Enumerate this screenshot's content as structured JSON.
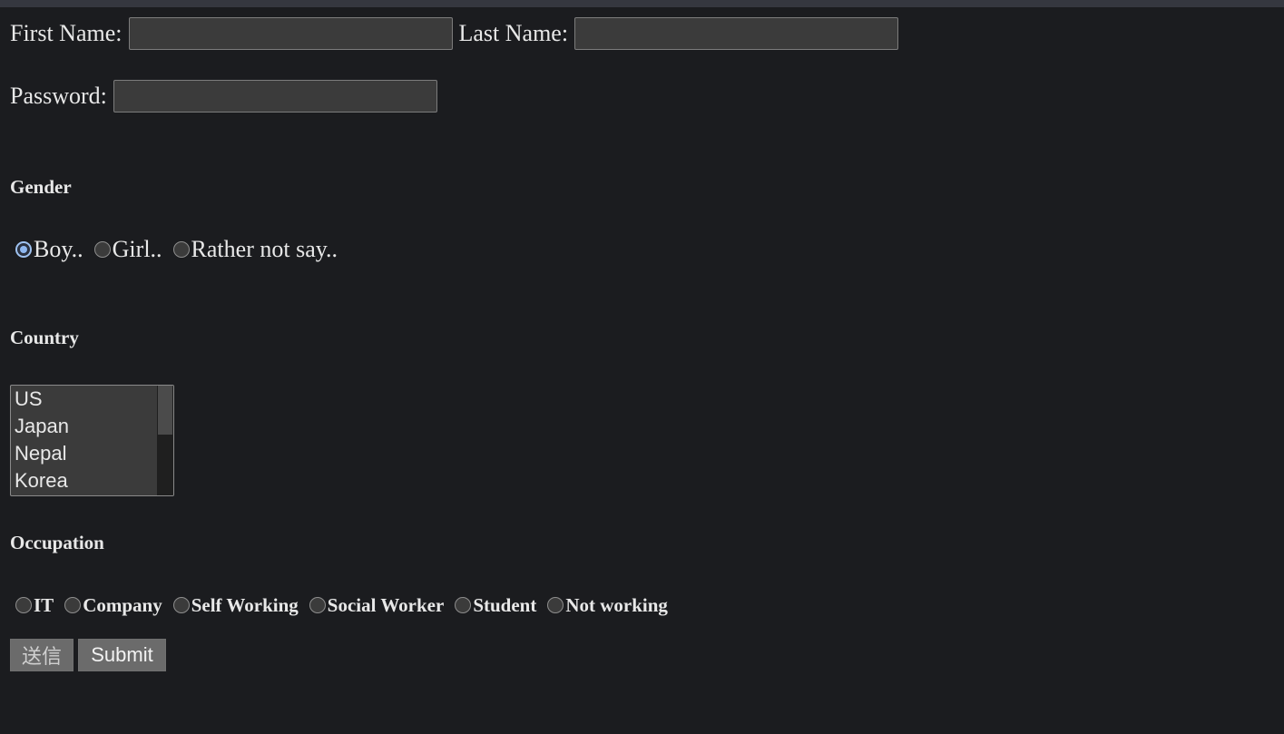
{
  "form": {
    "first_name_label": "First Name:",
    "last_name_label": "Last Name:",
    "password_label": "Password:",
    "first_name_value": "",
    "last_name_value": "",
    "password_value": ""
  },
  "gender": {
    "title": "Gender",
    "options": [
      "Boy..",
      "Girl..",
      "Rather not say.."
    ],
    "selected": "Boy.."
  },
  "country": {
    "title": "Country",
    "options": [
      "US",
      "Japan",
      "Nepal",
      "Korea"
    ]
  },
  "occupation": {
    "title": "Occupation",
    "options": [
      "IT",
      "Company",
      "Self Working",
      "Social Worker",
      "Student",
      "Not working"
    ]
  },
  "buttons": {
    "send_label": "送信",
    "submit_label": "Submit"
  },
  "colors": {
    "background": "#1b1c1f",
    "input_background": "#3b3b3b",
    "button_background": "#6b6b6b",
    "radio_checked": "#8fb8f0"
  }
}
